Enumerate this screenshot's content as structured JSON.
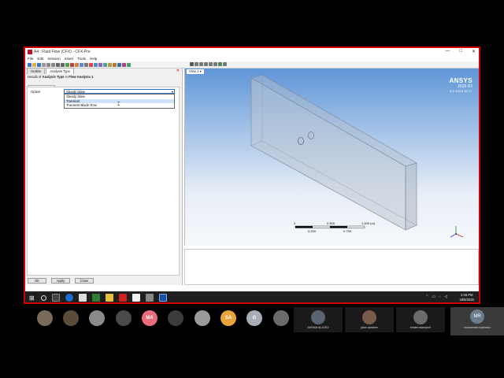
{
  "window": {
    "title": "A4 : Fluid Flow (CFX) - CFX-Pre",
    "controls": [
      "—",
      "□",
      "✕"
    ]
  },
  "menu": [
    "File",
    "Edit",
    "Session",
    "Insert",
    "Tools",
    "Help"
  ],
  "panel": {
    "tabs": [
      "Outline",
      "Analysis Type"
    ],
    "details_prefix": "Details of",
    "details_object": "Analysis Type",
    "details_in": "in",
    "details_parent": "Flow Analysis 1",
    "subtab": "Basic Settings",
    "option_label": "Option",
    "option_value": "Steady State",
    "dropdown_options": [
      "Steady State",
      "Transient",
      "Transient Blade Row"
    ],
    "highlighted_option": "Transient",
    "buttons": {
      "ok": "OK",
      "apply": "Apply",
      "close": "Close"
    }
  },
  "viewport": {
    "view_label": "View 1",
    "brand": "ANSYS",
    "release": "2019 R2",
    "edition": "ACADEMIC",
    "scale_labels_top": [
      "0",
      "0.500",
      "1.000 (m)"
    ],
    "scale_labels_bottom": [
      "0.250",
      "0.750"
    ]
  },
  "taskbar": {
    "time": "3:46 PM",
    "date": "28/9/2020"
  },
  "participants": [
    {
      "initials": "",
      "color": "#7a6a5a"
    },
    {
      "initials": "",
      "color": "#5b4b3b"
    },
    {
      "initials": "",
      "color": "#8a8a8a"
    },
    {
      "initials": "",
      "color": "#4a4a4a"
    },
    {
      "initials": "MA",
      "color": "#e86c7a"
    },
    {
      "initials": "",
      "color": "#3b3b3b"
    },
    {
      "initials": "",
      "color": "#9a9a9a"
    },
    {
      "initials": "SA",
      "color": "#e8a33b"
    },
    {
      "initials": "G",
      "color": "#a7adb5"
    },
    {
      "initials": "",
      "color": "#6a6a6a"
    }
  ],
  "named_tiles": [
    {
      "name": "AKRAM ALAZEZ",
      "color": "#5a6470"
    },
    {
      "name": "jalan abrahim",
      "color": "#7a5a4a"
    },
    {
      "name": "khaled alamphel",
      "color": "#6a6a6a"
    }
  ],
  "active_speaker": {
    "initials": "MR",
    "name": "muhammed nadhreed"
  }
}
